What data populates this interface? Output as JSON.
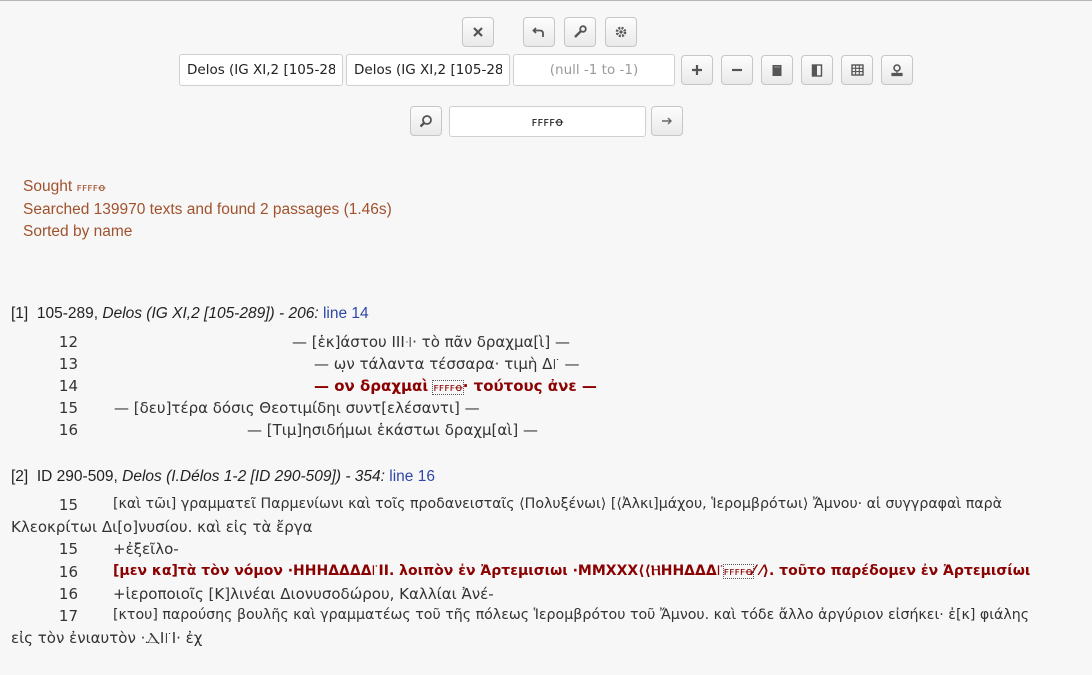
{
  "toolbar": {
    "search_box_value": "ꜰꜰꜰꜰꝋ",
    "range_placeholder": "(null -1 to -1)",
    "select_from": "Delos (IG XI,2 [105-289])",
    "select_to": "Delos (IG XI,2 [105-289])"
  },
  "icons": [
    "close-icon",
    "undo-icon",
    "wrench-icon",
    "gear-icon",
    "plus-icon",
    "minus-icon",
    "book-full-icon",
    "book-half-icon",
    "grid-icon",
    "stamp-icon",
    "search-icon",
    "arrow-right-icon"
  ],
  "status": {
    "sought_label": "Sought",
    "sought_value": "ꜰꜰꜰꜰꝋ",
    "searched": "Searched 139970 texts and found 2 passages (1.46s)",
    "sorted": "Sorted by name"
  },
  "passages": [
    {
      "index": "[1]",
      "ref_num": "105-289,",
      "site": "Delos (IG XI,2 [105-289])",
      "score": "- 206:",
      "line_link": "line 14",
      "lines": [
        {
          "num": "12",
          "text": "— [ἑκ]άστου ΙΙΙ꜊· τὸ πᾶν δραχμα[ὶ] —"
        },
        {
          "num": "13",
          "text": "— ω̣ν τάλαντα τέσσαρα· τιμὴ Δ꜍ —"
        },
        {
          "num": "14",
          "pre": "— ον δραχμαὶ ",
          "match": "ꜰꜰꜰꜰꝋ",
          "post": "· τούτους ἀνε —"
        },
        {
          "num": "15",
          "text": "— [δευ]τέρα δόσις Θεοτιμίδηι συντ[ελέσαντι] —"
        },
        {
          "num": "16",
          "text": "— [Τιμ]ησιδήμωι ἑκάστωι δραχμ[αὶ] —"
        }
      ]
    },
    {
      "index": "[2]",
      "ref_num": "ID 290-509,",
      "site": "Delos (I.Délos 1-2 [ID 290-509])",
      "score": "- 354:",
      "line_link": "line 16",
      "lines": [
        {
          "num": "15",
          "text": "[καὶ τῶι] γραμματεῖ Παρμενίωνι καὶ τοῖς προδανεισταῖς ⟨Πολυξένωι⟩ [⟨Ἀλκι]μάχου, Ἱερομβρότωι⟩ Ἄμνου· αἱ συγγραφαὶ παρὰ",
          "cont": "Κλεοκρίτωι Δι[ο]νυσίου. καὶ εἰς τὰ ἔργα"
        },
        {
          "num": "15",
          "text": "+ἐξεῖλο-"
        },
        {
          "num": "16",
          "pre": "[μεν κα]τὰ τὸν νόμον ·ΗΗΗΔΔΔΔ꜍ΙΙ. λοιπὸν ἐν Ἀρτεμισιωι ·ΜΜΧΧΧ⟨⟨ⲎΗΗΔΔΔ꜍",
          "match": "ꜰꜰꜰꜰꝋ",
          "post": "⁄ ⁄⟩. τοῦτο παρέδομεν ἐν Ἀρτεμισίωι"
        },
        {
          "num": "16",
          "text": "+ἱεροποιοῖς [Κ]λινέαι Διονυσοδώρου, Καλλίαι Ἀνέ-"
        },
        {
          "num": "17",
          "text": "[κτου] παρούσης βουλῆς καὶ γραμματέως τοῦ τῆς πόλεως Ἱερομβρότου τοῦ Ἄμνου. καὶ τόδε ἄλλο ἀργύριον εἰσήκει· ἐ[κ] φιάλης",
          "cont": "εἰς τὸν ἐνιαυτὸν ·ⲆΙ꜍Ι· ἐχ"
        }
      ]
    }
  ]
}
